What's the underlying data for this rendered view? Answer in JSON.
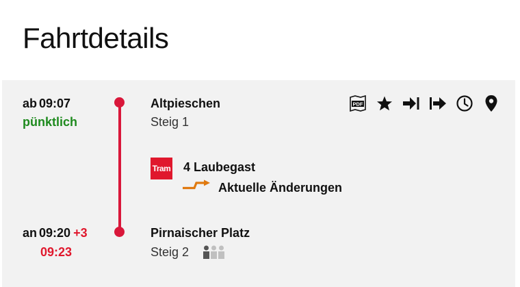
{
  "page": {
    "title": "Fahrtdetails"
  },
  "departure": {
    "prefix": "ab",
    "time": "09:07",
    "status": "pünktlich",
    "stop": "Altpieschen",
    "platform": "Steig 1"
  },
  "leg": {
    "mode_badge": "Tram",
    "line": "4 Laubegast",
    "changes_label": "Aktuelle Änderungen"
  },
  "arrival": {
    "prefix": "an",
    "time": "09:20",
    "delay": "+3",
    "actual_time": "09:23",
    "stop": "Pirnaischer Platz",
    "platform": "Steig 2",
    "occupancy_level": 1,
    "occupancy_max": 3
  },
  "actions": {
    "icons": [
      "pdf-icon",
      "star-icon",
      "arrow-to-bar-icon",
      "arrow-right-icon",
      "clock-icon",
      "map-pin-icon"
    ]
  },
  "colors": {
    "accent_red": "#e0182d",
    "route_line": "#d9173a",
    "status_green": "#1e8a1e",
    "changes_orange": "#e07a10",
    "panel_bg": "#f2f2f2"
  }
}
